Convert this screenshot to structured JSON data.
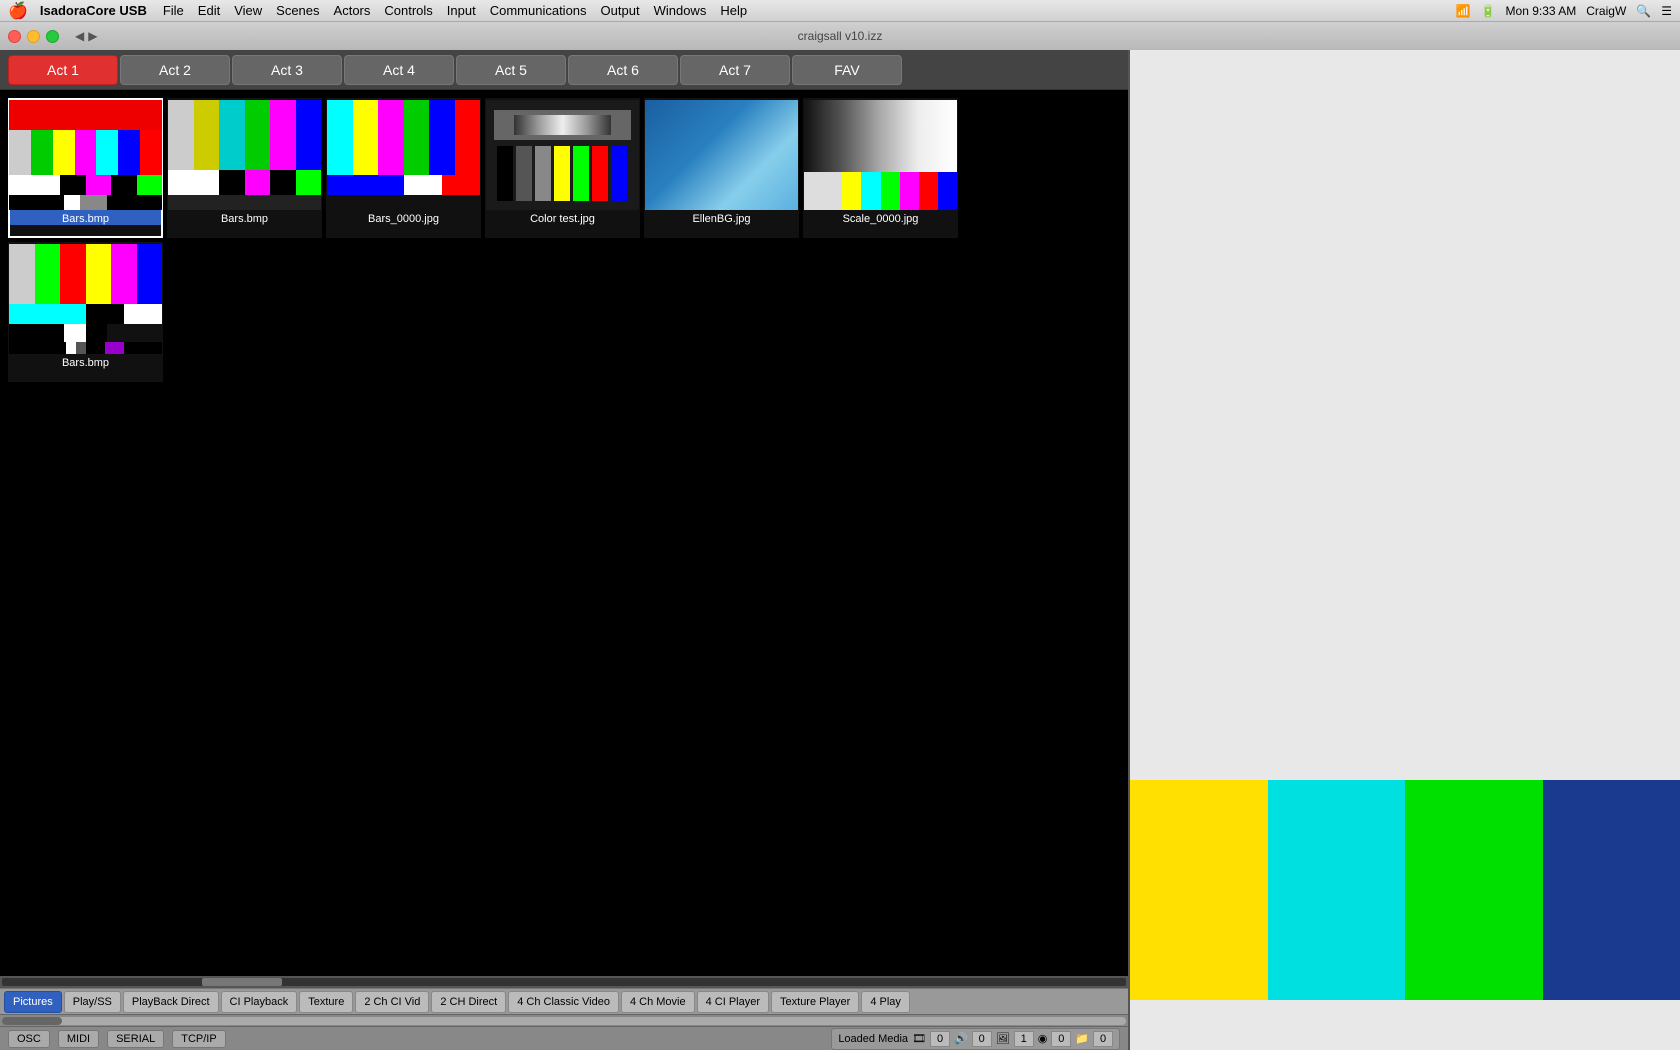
{
  "menubar": {
    "apple": "🍎",
    "appname": "IsadoraCore USB",
    "items": [
      "File",
      "Edit",
      "View",
      "Scenes",
      "Actors",
      "Controls",
      "Input",
      "Communications",
      "Output",
      "Windows",
      "Help"
    ],
    "right": {
      "time": "Mon 9:33 AM",
      "user": "CraigW"
    }
  },
  "titlebar": {
    "title": "craigsall v10.izz"
  },
  "acts": {
    "tabs": [
      {
        "label": "Act 1",
        "active": true
      },
      {
        "label": "Act 2",
        "active": false
      },
      {
        "label": "Act 3",
        "active": false
      },
      {
        "label": "Act 4",
        "active": false
      },
      {
        "label": "Act 5",
        "active": false
      },
      {
        "label": "Act 6",
        "active": false
      },
      {
        "label": "Act 7",
        "active": false
      },
      {
        "label": "FAV",
        "active": false
      }
    ]
  },
  "media_items": [
    {
      "name": "Bars.bmp",
      "type": "bars",
      "selected": true
    },
    {
      "name": "Bars.bmp",
      "type": "bars2",
      "selected": false
    },
    {
      "name": "Bars_0000.jpg",
      "type": "bars3",
      "selected": false
    },
    {
      "name": "Color test.jpg",
      "type": "colortest",
      "selected": false
    },
    {
      "name": "EllenBG.jpg",
      "type": "ellenbg",
      "selected": false
    },
    {
      "name": "Scale_0000.jpg",
      "type": "scale",
      "selected": false
    },
    {
      "name": "Bars.bmp",
      "type": "bars4",
      "selected": false
    }
  ],
  "bottom_tabs": [
    {
      "label": "Pictures",
      "active": true
    },
    {
      "label": "Play/SS",
      "active": false
    },
    {
      "label": "PlayBack Direct",
      "active": false
    },
    {
      "label": "CI Playback",
      "active": false
    },
    {
      "label": "Texture",
      "active": false
    },
    {
      "label": "2 Ch CI Vid",
      "active": false
    },
    {
      "label": "2 CH Direct",
      "active": false
    },
    {
      "label": "4 Ch Classic Video",
      "active": false
    },
    {
      "label": "4 Ch Movie",
      "active": false
    },
    {
      "label": "4 CI Player",
      "active": false
    },
    {
      "label": "Texture Player",
      "active": false
    },
    {
      "label": "4 Play",
      "active": false
    }
  ],
  "status_buttons": [
    {
      "label": "OSC",
      "active": false
    },
    {
      "label": "MIDI",
      "active": false
    },
    {
      "label": "SERIAL",
      "active": false
    },
    {
      "label": "TCP/IP",
      "active": false
    }
  ],
  "loaded_media": {
    "label": "Loaded Media",
    "counts": [
      0,
      0,
      1,
      0,
      0
    ]
  }
}
